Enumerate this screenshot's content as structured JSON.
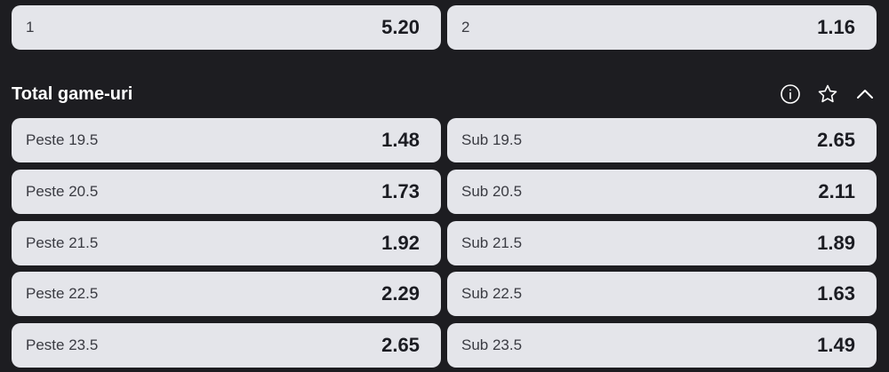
{
  "top_market": {
    "left": {
      "label": "1",
      "odds": "5.20"
    },
    "right": {
      "label": "2",
      "odds": "1.16"
    }
  },
  "total_games": {
    "title": "Total game-uri",
    "icons": [
      "info-icon",
      "star-icon",
      "chevron-up-icon"
    ],
    "rows": [
      {
        "over_label": "Peste 19.5",
        "over_odds": "1.48",
        "under_label": "Sub 19.5",
        "under_odds": "2.65"
      },
      {
        "over_label": "Peste 20.5",
        "over_odds": "1.73",
        "under_label": "Sub 20.5",
        "under_odds": "2.11"
      },
      {
        "over_label": "Peste 21.5",
        "over_odds": "1.92",
        "under_label": "Sub 21.5",
        "under_odds": "1.89"
      },
      {
        "over_label": "Peste 22.5",
        "over_odds": "2.29",
        "under_label": "Sub 22.5",
        "under_odds": "1.63"
      },
      {
        "over_label": "Peste 23.5",
        "over_odds": "2.65",
        "under_label": "Sub 23.5",
        "under_odds": "1.49"
      }
    ]
  }
}
